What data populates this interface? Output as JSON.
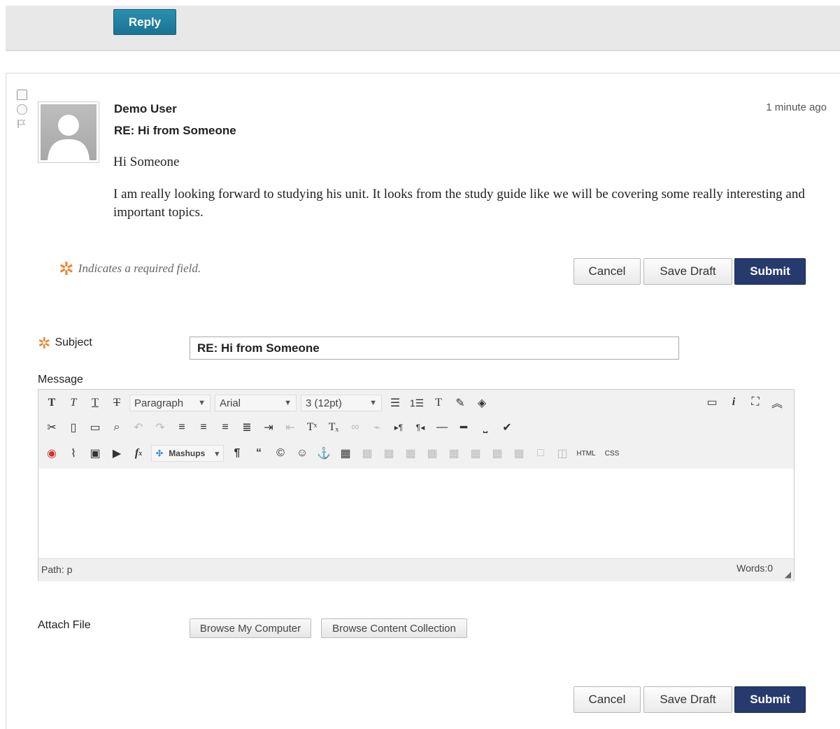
{
  "topbar": {
    "reply_label": "Reply"
  },
  "post": {
    "author": "Demo User",
    "subject": "RE: Hi from Someone",
    "timestamp": "1 minute ago",
    "body": [
      "Hi Someone",
      "I am really looking forward to studying his unit. It looks from the study guide like we will be covering some really interesting and important topics."
    ]
  },
  "form": {
    "required_note": "Indicates a required field.",
    "cancel_label": "Cancel",
    "save_draft_label": "Save Draft",
    "submit_label": "Submit",
    "subject_label": "Subject",
    "subject_value": "RE: Hi from Someone",
    "message_label": "Message",
    "attach_label": "Attach File",
    "browse_computer_label": "Browse My Computer",
    "browse_collection_label": "Browse Content Collection"
  },
  "editor": {
    "format_value": "Paragraph",
    "font_value": "Arial",
    "size_value": "3 (12pt)",
    "mashups_label": "Mashups",
    "html_label": "HTML",
    "css_label": "CSS",
    "path_label": "Path: p",
    "words_label": "Words:0"
  },
  "colors": {
    "reply": "#1b7393",
    "submit": "#263a6e",
    "required_star": "#f0832b"
  }
}
